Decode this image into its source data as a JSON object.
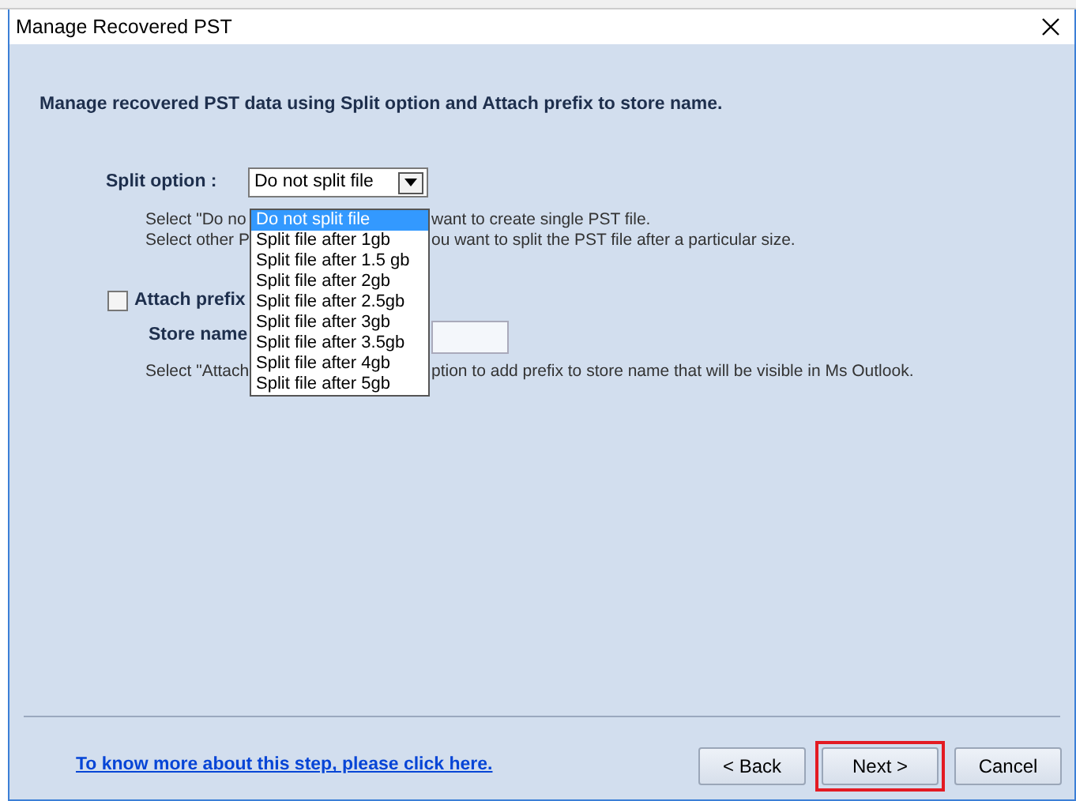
{
  "window": {
    "title": "Manage Recovered PST"
  },
  "intro": "Manage recovered PST data using Split option and Attach prefix to store name.",
  "split": {
    "label": "Split option :",
    "value": "Do not split file",
    "hint_lines": [
      {
        "left": "Select \"Do no",
        "right": "want to create single PST file."
      },
      {
        "left": "Select other P",
        "right": "ou want to split the PST file after a particular size."
      }
    ],
    "dropdown_options": [
      {
        "label": "Do not split file",
        "selected": true
      },
      {
        "label": "Split file after 1gb",
        "selected": false
      },
      {
        "label": "Split file after 1.5 gb",
        "selected": false
      },
      {
        "label": "Split file after 2gb",
        "selected": false
      },
      {
        "label": "Split file after 2.5gb",
        "selected": false
      },
      {
        "label": "Split file after 3gb",
        "selected": false
      },
      {
        "label": "Split file after 3.5gb",
        "selected": false
      },
      {
        "label": "Split file after 4gb",
        "selected": false
      },
      {
        "label": "Split file after 5gb",
        "selected": false
      }
    ]
  },
  "prefix": {
    "label": "Attach prefix",
    "checked": false,
    "store_name_label": "Store name",
    "hint": {
      "left": "Select \"Attach",
      "right": "ption to add prefix to store name that will be visible in Ms Outlook."
    }
  },
  "help_link": "To know more about this step, please click here.",
  "buttons": [
    {
      "label": "< Back",
      "highlighted": false
    },
    {
      "label": "Next >",
      "highlighted": true
    },
    {
      "label": "Cancel",
      "highlighted": false
    }
  ]
}
